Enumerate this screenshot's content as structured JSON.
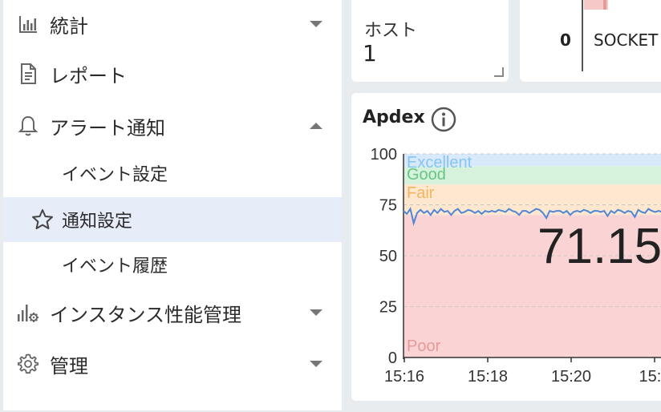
{
  "sidebar": {
    "items": [
      {
        "label": "統計",
        "icon": "bar-chart-icon",
        "caret": "down"
      },
      {
        "label": "レポート",
        "icon": "document-icon"
      },
      {
        "label": "アラート通知",
        "icon": "bell-icon",
        "caret": "up"
      },
      {
        "label": "イベント設定"
      },
      {
        "label": "通知設定",
        "icon": "star-icon",
        "active": true
      },
      {
        "label": "イベント履歴"
      },
      {
        "label": "インスタンス性能管理",
        "icon": "performance-gear-icon",
        "caret": "down"
      },
      {
        "label": "管理",
        "icon": "gear-icon",
        "caret": "down"
      }
    ]
  },
  "host_card": {
    "title": "ホスト",
    "value": "1"
  },
  "socket_card": {
    "count": "0",
    "label": "SOCKET"
  },
  "apdex": {
    "title": "Apdex",
    "value": "71.15",
    "colors": {
      "excellent_band": "#d8e9fb",
      "good_band": "#d6f1dc",
      "fair_band": "#fde8cf",
      "poor_band": "#fad4d4",
      "line": "#4f86d6",
      "excellent_text": "#86c5f2",
      "good_text": "#66c784",
      "fair_text": "#f2b55f",
      "poor_text": "#e69a9a"
    },
    "chart_data": {
      "type": "line",
      "title": "Apdex",
      "ylim": [
        0,
        100
      ],
      "y_ticks": [
        0,
        25,
        50,
        75,
        100
      ],
      "x_ticks": [
        "15:16",
        "15:18",
        "15:20",
        "15:2"
      ],
      "bands": [
        {
          "label": "Excellent",
          "from": 94,
          "to": 100
        },
        {
          "label": "Good",
          "from": 85,
          "to": 94
        },
        {
          "label": "Fair",
          "from": 70,
          "to": 85
        },
        {
          "label": "Poor",
          "from": 0,
          "to": 70
        }
      ],
      "series": [
        {
          "values": [
            72,
            70.5,
            73,
            66,
            71,
            72.5,
            71,
            72,
            70,
            72.5,
            71,
            73,
            71.5,
            72,
            70,
            72,
            73,
            71,
            71.5,
            72.5,
            72,
            71,
            72,
            70.5,
            72,
            71.5,
            72,
            71.5,
            72.5,
            72,
            71.5,
            73,
            72,
            71.5,
            70,
            72,
            72,
            71,
            72,
            73,
            72.5,
            71,
            68.5,
            72,
            71.5,
            72,
            72,
            71,
            72,
            70,
            71.5,
            72,
            71.5,
            72.5,
            72,
            71,
            72,
            72,
            71.5,
            72,
            69.5,
            72,
            71,
            72.5,
            72,
            71,
            72,
            71.5,
            69,
            72.5,
            71.5,
            71,
            73,
            72,
            71.5,
            72,
            71.5,
            71,
            72,
            71.5
          ]
        }
      ]
    }
  }
}
